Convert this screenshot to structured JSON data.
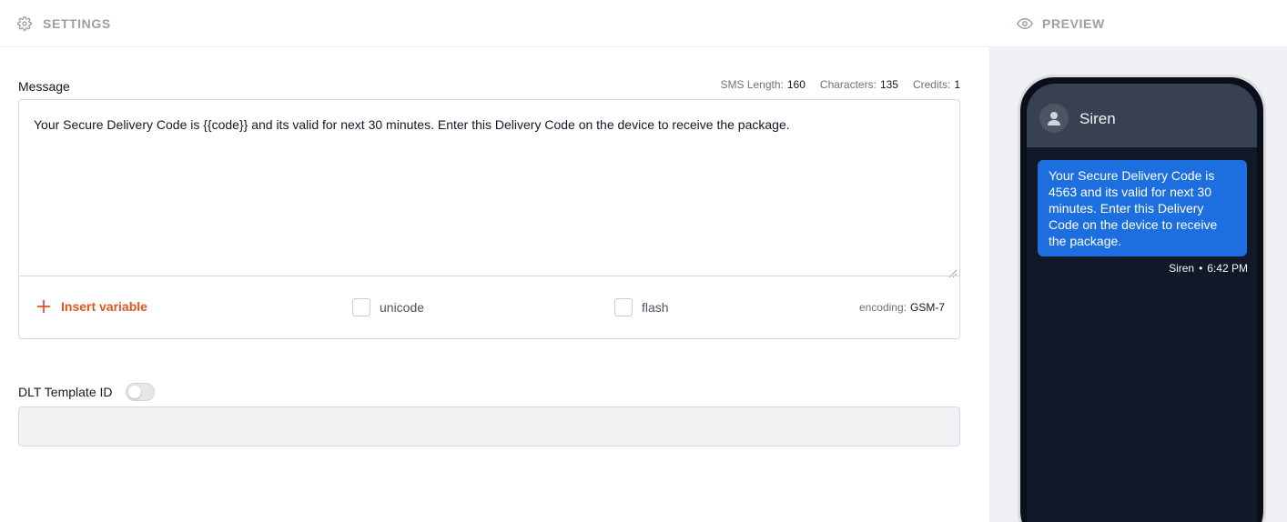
{
  "settings": {
    "title": "SETTINGS",
    "message_label": "Message",
    "stats": {
      "sms_length_label": "SMS Length:",
      "sms_length_value": "160",
      "characters_label": "Characters:",
      "characters_value": "135",
      "credits_label": "Credits:",
      "credits_value": "1"
    },
    "message_text": "Your Secure Delivery Code is {{code}} and its valid for next 30 minutes. Enter this Delivery Code on the device to receive the package.",
    "insert_variable_label": "Insert variable",
    "unicode_label": "unicode",
    "unicode_checked": false,
    "flash_label": "flash",
    "flash_checked": false,
    "encoding_label": "encoding:",
    "encoding_value": "GSM-7",
    "dlt_label": "DLT Template ID",
    "dlt_enabled": false,
    "dlt_value": ""
  },
  "preview": {
    "title": "PREVIEW",
    "contact_name": "Siren",
    "bubble_text": "Your Secure Delivery Code is 4563 and its valid for next 30 minutes. Enter this Delivery Code on the device to receive the package.",
    "sender": "Siren",
    "separator": "•",
    "time": "6:42 PM"
  },
  "colors": {
    "accent": "#e0561f",
    "bubble": "#1d6fe0",
    "phone_header": "#374151",
    "phone_screen": "#111827"
  },
  "icons": {
    "settings": "gear-icon",
    "preview": "eye-icon",
    "insert": "plus-icon",
    "avatar": "user-icon"
  }
}
